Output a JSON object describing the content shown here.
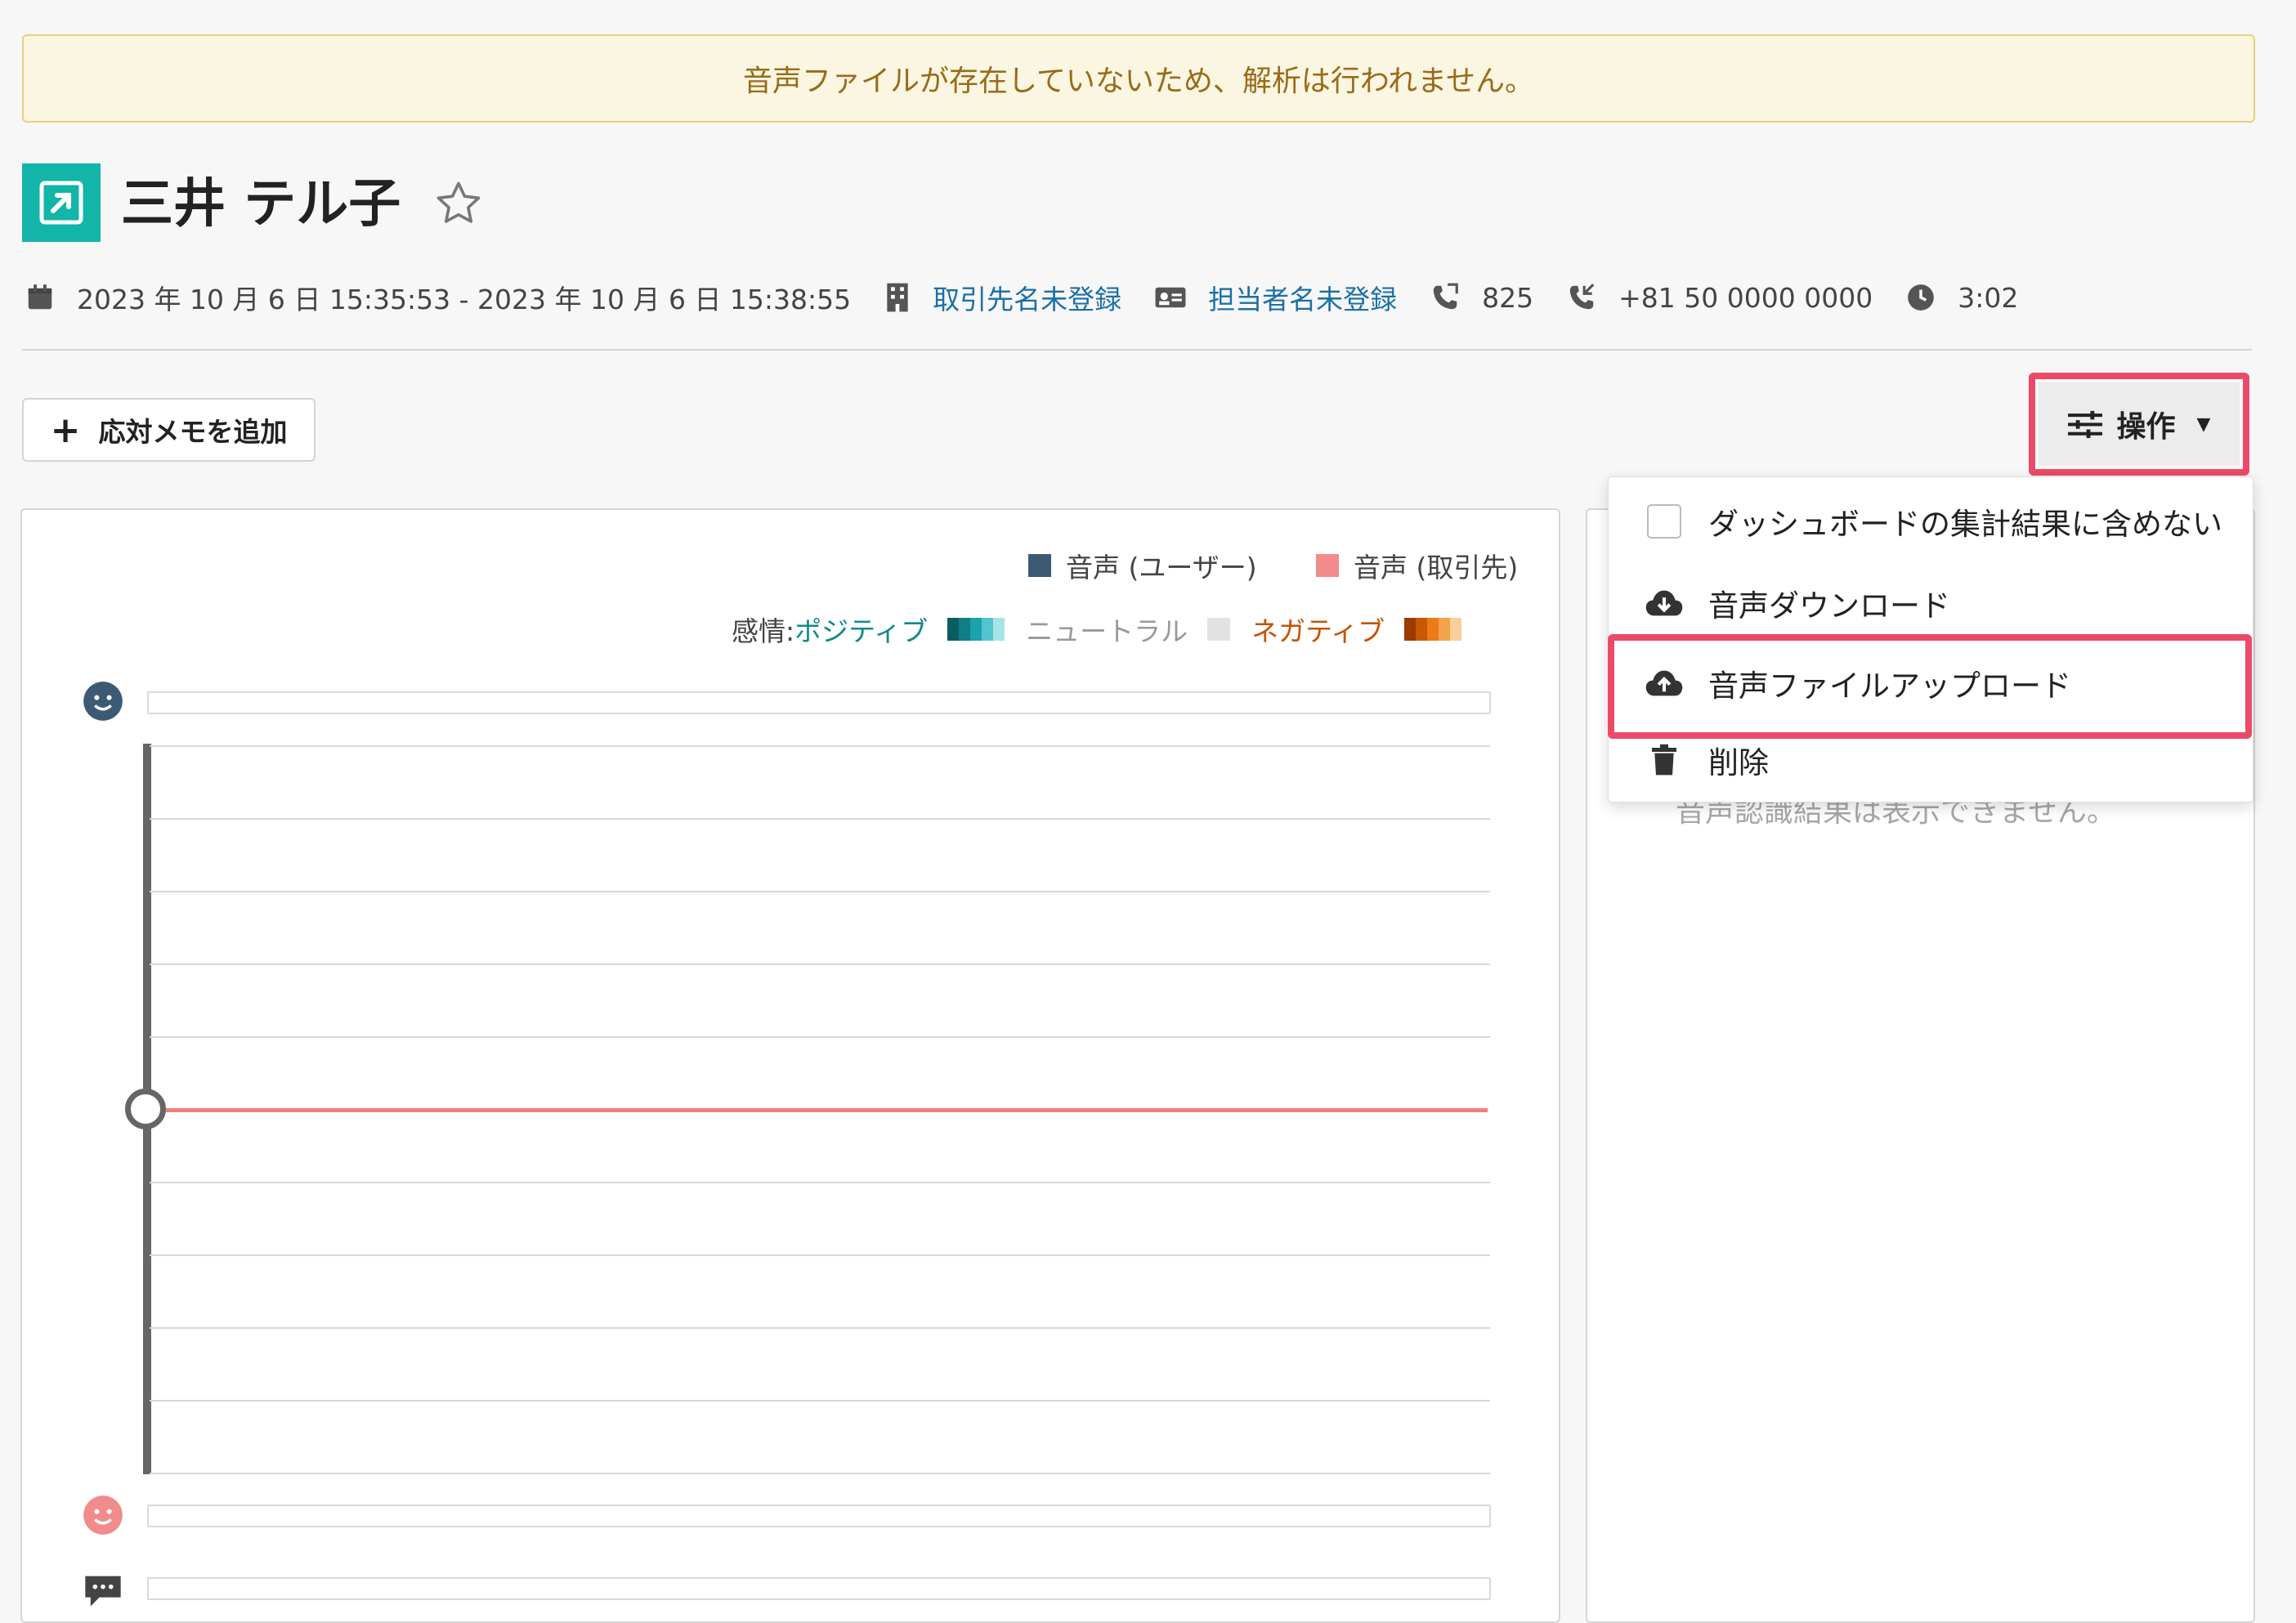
{
  "banner": {
    "message": "音声ファイルが存在していないため、解析は行われません。"
  },
  "header": {
    "title": "三井 テル子"
  },
  "meta": {
    "datetime_range": "2023 年 10 月 6 日 15:35:53 - 2023 年 10 月 6 日 15:38:55",
    "account": "取引先名未登録",
    "contact": "担当者名未登録",
    "extension": "825",
    "phone_number": "+81 50 0000 0000",
    "duration": "3:02"
  },
  "toolbar": {
    "add_memo_label": "応対メモを追加",
    "operations_label": "操作"
  },
  "chart": {
    "legend_user": "音声 (ユーザー)",
    "legend_account": "音声 (取引先)",
    "emotion_prefix": "感情:",
    "emotion_positive": "ポジティブ",
    "emotion_neutral": "ニュートラル",
    "emotion_negative": "ネガティブ",
    "colors": {
      "user": "#3d5a75",
      "account": "#f28b8b",
      "positive": [
        "#0b5c63",
        "#137d86",
        "#1aa2ad",
        "#52c6cf",
        "#a6e4e8"
      ],
      "neutral": "#e2e2e2",
      "negative": [
        "#9b3b00",
        "#c75a00",
        "#ee7a1a",
        "#f5a24c",
        "#f9cf9c"
      ]
    }
  },
  "right_panel": {
    "message": "音声認識結果は表示できません。"
  },
  "dropdown": {
    "items": [
      {
        "label": "ダッシュボードの集計結果に含めない",
        "icon": "checkbox"
      },
      {
        "label": "音声ダウンロード",
        "icon": "cloud-download-icon"
      },
      {
        "label": "音声ファイルアップロード",
        "icon": "cloud-upload-icon"
      },
      {
        "label": "削除",
        "icon": "trash-icon"
      }
    ]
  }
}
